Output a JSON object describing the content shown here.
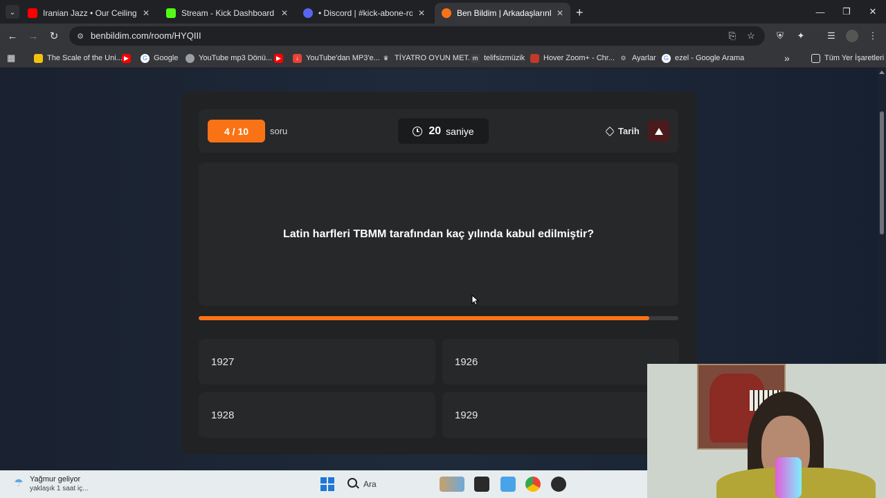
{
  "browser": {
    "tabs": [
      {
        "title": "Iranian Jazz • Our Ceilings Fell A",
        "favicon_color": "#ff0000"
      },
      {
        "title": "Stream - Kick Dashboard",
        "favicon_color": "#53fc18"
      },
      {
        "title": "• Discord | #kick-abone-rolu-alı",
        "favicon_color": "#5865f2"
      },
      {
        "title": "Ben Bildim | Arkadaşlarınla Onli",
        "favicon_color": "#f97316"
      }
    ],
    "url": "benbildim.com/room/HYQIII",
    "bookmarks": [
      {
        "label": "The Scale of the Uni...",
        "color": "#f4c20d"
      },
      {
        "label": "",
        "color": "#ff0000"
      },
      {
        "label": "Google",
        "color": "#4285f4"
      },
      {
        "label": "YouTube mp3 Dönü...",
        "color": "#9aa0a6"
      },
      {
        "label": "",
        "color": "#ff0000"
      },
      {
        "label": "YouTube'dan MP3'e...",
        "color": "#e94235"
      },
      {
        "label": "TİYATRO OYUN MET...",
        "color": "#e3e3e3"
      },
      {
        "label": "telifsizmüzik",
        "color": "#3c4043"
      },
      {
        "label": "Hover Zoom+ - Chr...",
        "color": "#c0392b"
      },
      {
        "label": "Ayarlar",
        "color": "#9aa0a6"
      },
      {
        "label": "ezel - Google Arama",
        "color": "#4285f4"
      }
    ],
    "bookmarks_more": "»",
    "all_bookmarks": "Tüm Yer İşaretleri"
  },
  "quiz": {
    "counter": "4 / 10",
    "counter_unit": "soru",
    "timer_value": "20",
    "timer_unit": "saniye",
    "category": "Tarih",
    "question": "Latin harfleri TBMM tarafından kaç yılında kabul edilmiştir?",
    "progress_percent": 94,
    "answers": [
      "1927",
      "1926",
      "1928",
      "1929"
    ],
    "accent_color": "#f97316"
  },
  "taskbar": {
    "weather_title": "Yağmur geliyor",
    "weather_sub": "yaklaşık 1 saat iç...",
    "search_label": "Ara"
  }
}
